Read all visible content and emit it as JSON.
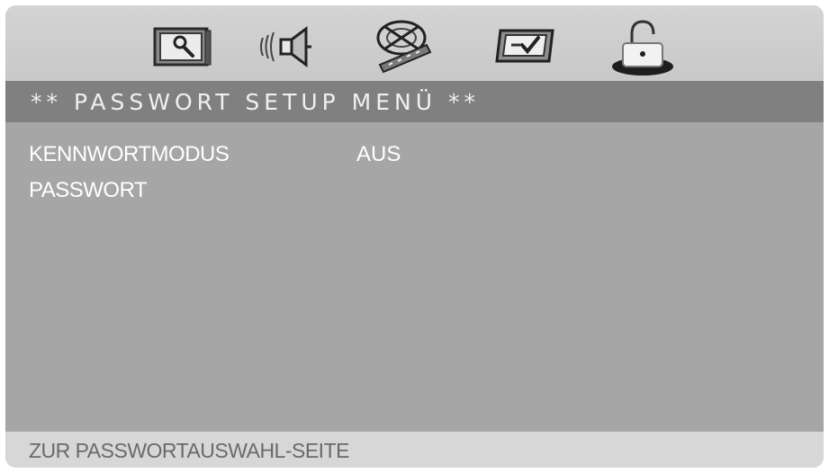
{
  "tabs": [
    {
      "icon": "general-setup-icon",
      "selected": false
    },
    {
      "icon": "audio-setup-icon",
      "selected": false
    },
    {
      "icon": "video-setup-icon",
      "selected": false
    },
    {
      "icon": "preference-setup-icon",
      "selected": false
    },
    {
      "icon": "password-lock-icon",
      "selected": true
    }
  ],
  "menu": {
    "title": "** PASSWORT SETUP MENÜ **",
    "rows": [
      {
        "label": "KENNWORTMODUS",
        "value": "AUS"
      },
      {
        "label": "PASSWORT",
        "value": ""
      }
    ]
  },
  "status": {
    "hint": "ZUR PASSWORTAUSWAHL-SEITE"
  },
  "colors": {
    "tabbar": "#cecece",
    "titlebar": "#808080",
    "content": "#a6a6a6",
    "statusbar": "#d7d7d7",
    "text": "#ffffff"
  }
}
